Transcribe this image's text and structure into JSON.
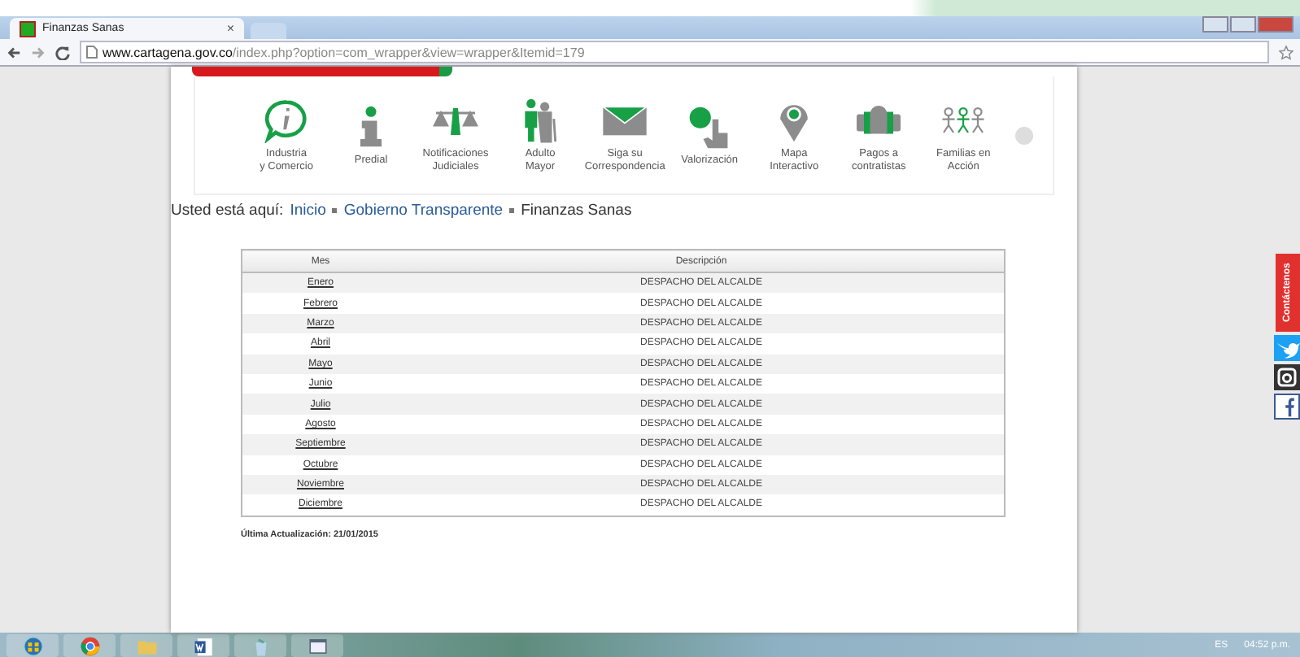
{
  "browser": {
    "tab": {
      "title": "Finanzas Sanas",
      "close": "×"
    },
    "url": {
      "host": "www.cartagena.gov.co",
      "path": "/index.php?option=com_wrapper&view=wrapper&Itemid=179"
    }
  },
  "services": [
    {
      "kind": "info",
      "lines": [
        "Industria",
        "y Comercio"
      ]
    },
    {
      "kind": "letter-i",
      "lines": [
        "Predial"
      ]
    },
    {
      "kind": "scales",
      "lines": [
        "Notificaciones",
        "Judiciales"
      ]
    },
    {
      "kind": "elders",
      "lines": [
        "Adulto",
        "Mayor"
      ]
    },
    {
      "kind": "envelope",
      "lines": [
        "Siga su",
        "Correspondencia"
      ]
    },
    {
      "kind": "coin-hand",
      "lines": [
        "Valorización"
      ]
    },
    {
      "kind": "pin",
      "lines": [
        "Mapa",
        "Interactivo"
      ]
    },
    {
      "kind": "people",
      "lines": [
        "Pagos a",
        "contratistas"
      ]
    },
    {
      "kind": "family",
      "lines": [
        "Familias en",
        "Acción"
      ]
    }
  ],
  "breadcrumb": {
    "prefix": "Usted está aquí:",
    "items": [
      {
        "text": "Inicio",
        "link": true
      },
      {
        "text": "Gobierno Transparente",
        "link": true
      },
      {
        "text": "Finanzas Sanas",
        "link": false
      }
    ]
  },
  "table": {
    "columns": [
      "Mes",
      "Descripción"
    ],
    "rows": [
      [
        "Enero",
        "DESPACHO DEL ALCALDE"
      ],
      [
        "Febrero",
        "DESPACHO DEL ALCALDE"
      ],
      [
        "Marzo",
        "DESPACHO DEL ALCALDE"
      ],
      [
        "Abril",
        "DESPACHO DEL ALCALDE"
      ],
      [
        "Mayo",
        "DESPACHO DEL ALCALDE"
      ],
      [
        "Junio",
        "DESPACHO DEL ALCALDE"
      ],
      [
        "Julio",
        "DESPACHO DEL ALCALDE"
      ],
      [
        "Agosto",
        "DESPACHO DEL ALCALDE"
      ],
      [
        "Septiembre",
        "DESPACHO DEL ALCALDE"
      ],
      [
        "Octubre",
        "DESPACHO DEL ALCALDE"
      ],
      [
        "Noviembre",
        "DESPACHO DEL ALCALDE"
      ],
      [
        "Diciembre",
        "DESPACHO DEL ALCALDE"
      ]
    ]
  },
  "updated": "Última Actualización: 21/01/2015",
  "social": {
    "contact": "Contáctenos",
    "links": [
      {
        "kind": "twitter"
      },
      {
        "kind": "instagram"
      },
      {
        "kind": "facebook"
      }
    ]
  },
  "taskbar": {
    "apps": [
      {
        "kind": "start"
      },
      {
        "kind": "chrome"
      },
      {
        "kind": "folder"
      },
      {
        "kind": "word"
      },
      {
        "kind": "recycle"
      },
      {
        "kind": "window"
      }
    ],
    "language": "ES",
    "time": "04:52 p.m."
  }
}
